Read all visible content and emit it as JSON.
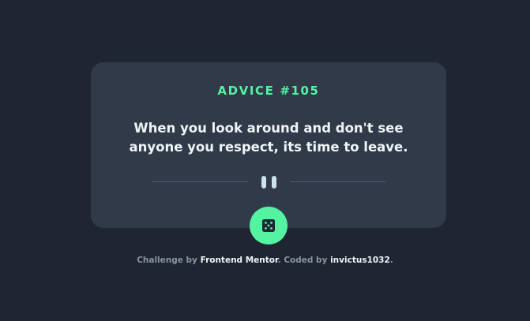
{
  "card": {
    "advice_label": "ADVICE #105",
    "advice_text": "When you look around and don't see anyone you respect, its time to leave."
  },
  "dice_button": {
    "icon": "dice-icon",
    "accent_color": "#53f3a2"
  },
  "attribution": {
    "prefix": "Challenge by ",
    "challenge_link": "Frontend Mentor",
    "middle": ". Coded by ",
    "author_link": "invictus1032",
    "suffix": "."
  },
  "colors": {
    "background": "#1f2632",
    "card": "#313a48",
    "accent": "#53f3a2",
    "text": "#eef4f7",
    "muted": "#8a93a3"
  }
}
